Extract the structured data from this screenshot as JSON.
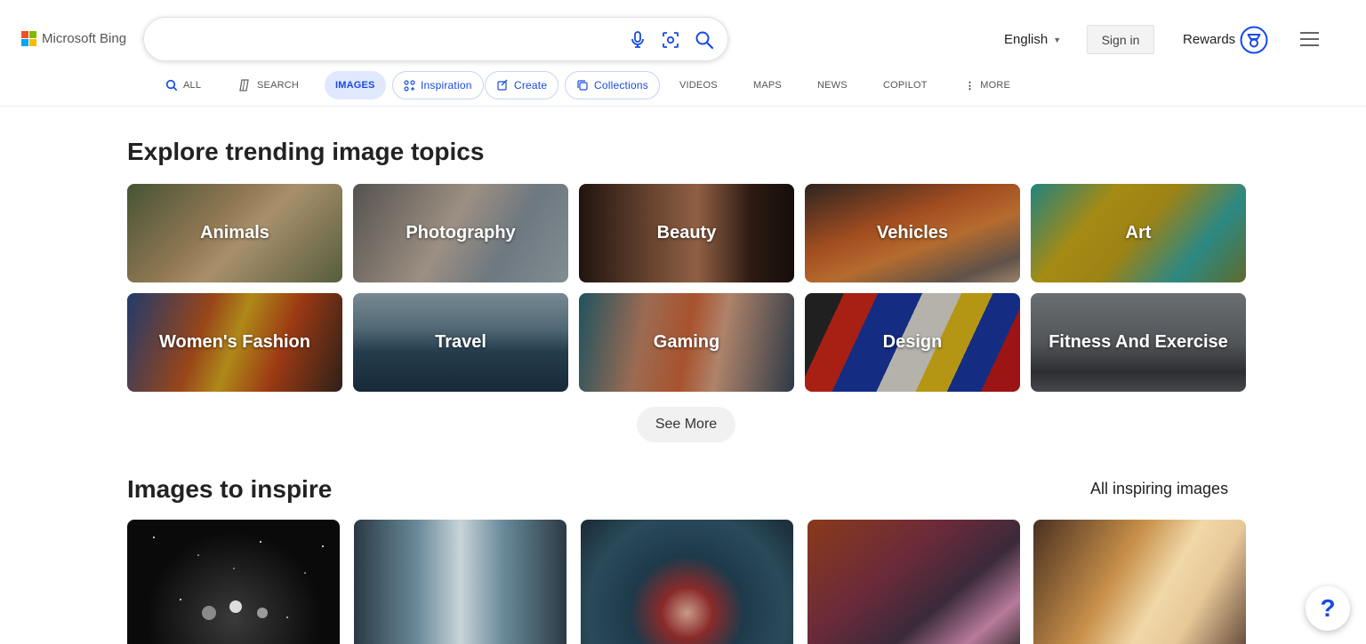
{
  "header": {
    "logo_text": "Microsoft Bing",
    "search": {
      "value": "",
      "placeholder": ""
    },
    "language": "English",
    "sign_in": "Sign in",
    "rewards": "Rewards"
  },
  "nav": [
    {
      "label": "ALL",
      "icon": "search-icon"
    },
    {
      "label": "SEARCH",
      "icon": "copilot-icon"
    },
    {
      "label": "IMAGES",
      "active": true
    },
    {
      "label": "Inspiration",
      "icon": "inspiration-icon"
    },
    {
      "label": "Create",
      "icon": "create-icon"
    },
    {
      "label": "Collections",
      "icon": "collections-icon"
    },
    {
      "label": "VIDEOS"
    },
    {
      "label": "MAPS"
    },
    {
      "label": "NEWS"
    },
    {
      "label": "COPILOT"
    },
    {
      "label": "MORE",
      "icon": "more-dots-icon"
    }
  ],
  "trending": {
    "title": "Explore trending image topics",
    "topics": [
      "Animals",
      "Photography",
      "Beauty",
      "Vehicles",
      "Art",
      "Women's Fashion",
      "Travel",
      "Gaming",
      "Design",
      "Fitness And Exercise"
    ],
    "see_more": "See More"
  },
  "inspire": {
    "title": "Images to inspire",
    "all_link": "All inspiring images"
  },
  "help_label": "?",
  "colors": {
    "accent": "#174ae4",
    "active_tab_bg": "#dfe8fd"
  }
}
